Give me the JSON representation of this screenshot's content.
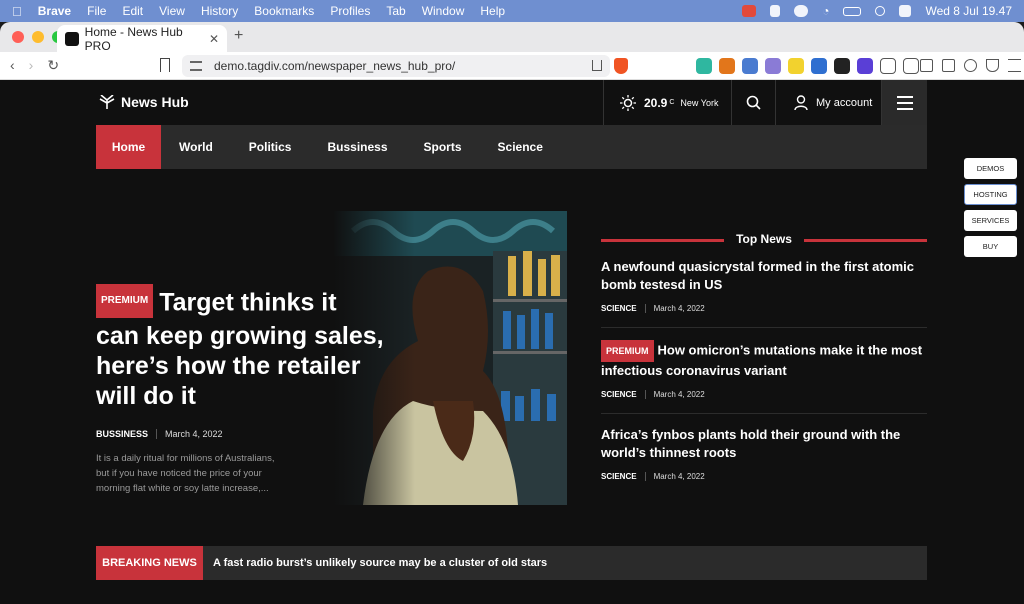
{
  "menubar": {
    "app": "Brave",
    "items": [
      "File",
      "Edit",
      "View",
      "History",
      "Bookmarks",
      "Profiles",
      "Tab",
      "Window",
      "Help"
    ],
    "datetime": "Wed 8 Jul  19.47"
  },
  "browser": {
    "tab_title": "Home - News Hub PRO",
    "url": "demo.tagdiv.com/newspaper_news_hub_pro/"
  },
  "site": {
    "logo": "News Hub",
    "weather": {
      "temp": "20.9",
      "unit": "C",
      "city": "New York"
    },
    "account_label": "My account",
    "nav": [
      "Home",
      "World",
      "Politics",
      "Bussiness",
      "Sports",
      "Science"
    ],
    "float_buttons": [
      "DEMOS",
      "HOSTING",
      "SERVICES",
      "BUY"
    ],
    "hero": {
      "badge": "PREMIUM",
      "title": "Target thinks it can keep growing sales, here’s how the retailer will do it",
      "category": "BUSSINESS",
      "date": "March 4, 2022",
      "excerpt": "It is a daily ritual for millions of Australians, but if you have noticed the price of your morning flat white or soy latte increase,..."
    },
    "top_news": {
      "heading": "Top News",
      "items": [
        {
          "badge": "",
          "title": "A newfound quasicrystal formed in the first atomic bomb testesd in US",
          "category": "SCIENCE",
          "date": "March 4, 2022"
        },
        {
          "badge": "PREMIUM",
          "title": "How omicron’s mutations make it the most infectious coronavirus variant",
          "category": "SCIENCE",
          "date": "March 4, 2022"
        },
        {
          "badge": "",
          "title": "Africa’s fynbos plants hold their ground with the world’s thinnest roots",
          "category": "SCIENCE",
          "date": "March 4, 2022"
        }
      ]
    },
    "breaking": {
      "label": "BREAKING NEWS",
      "headline": "A fast radio burst’s unlikely source may be a cluster of old stars"
    }
  }
}
